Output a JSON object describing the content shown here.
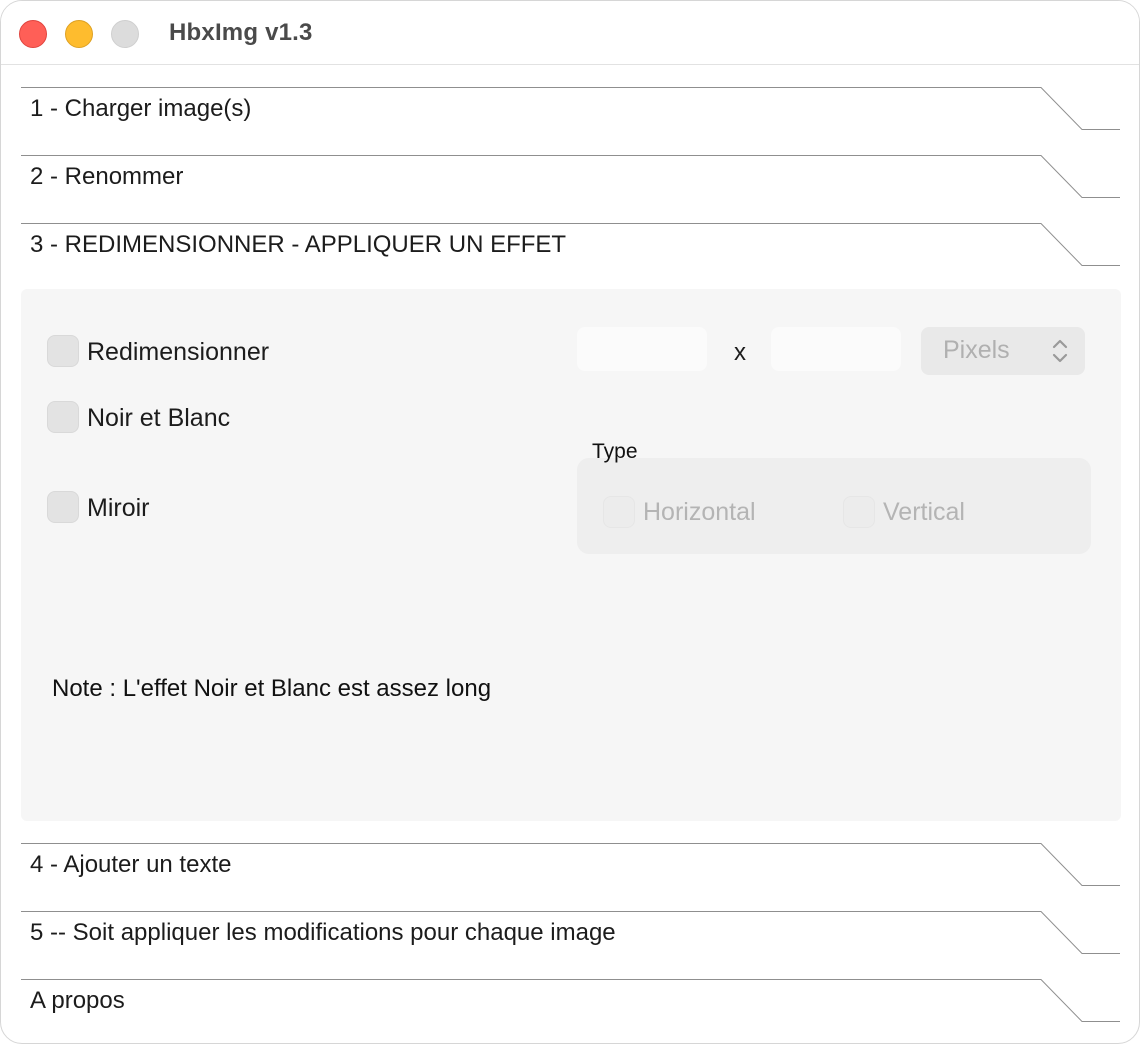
{
  "window": {
    "title": "HbxImg v1.3"
  },
  "sections": [
    {
      "label": "1 - Charger image(s)"
    },
    {
      "label": "2 - Renommer"
    },
    {
      "label": "3 - REDIMENSIONNER - APPLIQUER UN EFFET"
    },
    {
      "label": "4 - Ajouter un texte"
    },
    {
      "label": "5 -- Soit appliquer les modifications pour chaque image"
    },
    {
      "label": "A propos"
    }
  ],
  "effects_panel": {
    "resize": {
      "label": "Redimensionner",
      "checked": false
    },
    "width": {
      "value": ""
    },
    "times": "x",
    "height": {
      "value": ""
    },
    "unit": {
      "selected": "Pixels"
    },
    "bw": {
      "label": "Noir et Blanc",
      "checked": false
    },
    "mirror": {
      "label": "Miroir",
      "checked": false
    },
    "type_group": {
      "label": "Type",
      "horizontal": {
        "label": "Horizontal",
        "checked": false
      },
      "vertical": {
        "label": "Vertical",
        "checked": false
      }
    },
    "note": "Note : L'effet Noir et Blanc est assez long"
  },
  "icons": {
    "select_arrows": "up-down-chevron-icon"
  },
  "colors": {
    "close": "#ff5f57",
    "minimize": "#febc2e",
    "zoom_inactive": "#dcdcdc",
    "panel_bg": "#f6f6f6",
    "disabled_text": "#b4b4b4"
  }
}
